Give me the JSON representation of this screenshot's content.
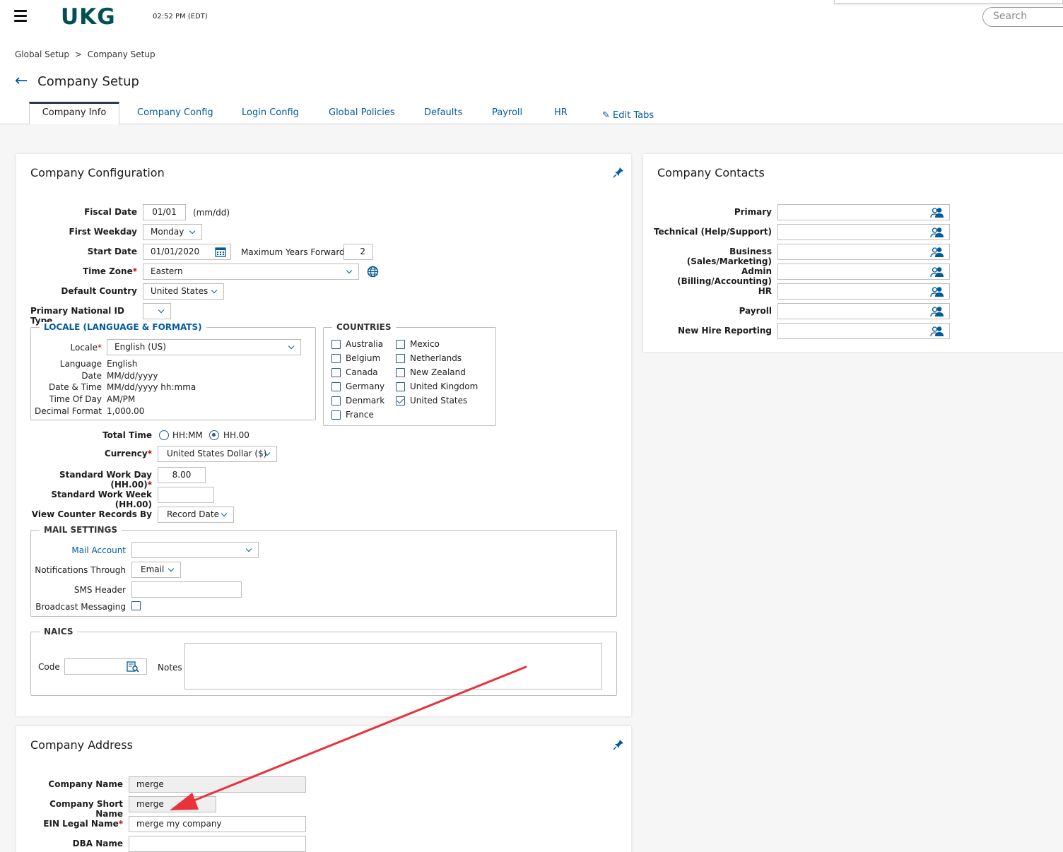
{
  "header": {
    "logo": "UKG",
    "clock": "02:52 PM (EDT)",
    "search_placeholder": "Search"
  },
  "breadcrumb": {
    "root": "Global Setup",
    "separator": ">",
    "current": "Company Setup"
  },
  "page_title": "Company Setup",
  "tabs": [
    {
      "label": "Company Info"
    },
    {
      "label": "Company Config"
    },
    {
      "label": "Login Config"
    },
    {
      "label": "Global Policies"
    },
    {
      "label": "Defaults"
    },
    {
      "label": "Payroll"
    },
    {
      "label": "HR"
    },
    {
      "label": "Edit Tabs"
    }
  ],
  "config": {
    "title": "Company Configuration",
    "fiscal_date_label": "Fiscal Date",
    "fiscal_date": "01/01",
    "fiscal_date_hint": "(mm/dd)",
    "first_weekday_label": "First Weekday",
    "first_weekday": "Monday",
    "start_date_label": "Start Date",
    "start_date": "01/01/2020",
    "max_years_label": "Maximum Years Forward",
    "max_years": "2",
    "time_zone_label": "Time Zone",
    "time_zone": "Eastern",
    "default_country_label": "Default Country",
    "default_country": "United States",
    "national_id_label": "Primary National ID Type",
    "national_id": "",
    "locale_legend": "LOCALE (LANGUAGE & FORMATS)",
    "locale_label": "Locale",
    "locale": "English (US)",
    "locale_details": [
      {
        "label": "Language",
        "value": "English"
      },
      {
        "label": "Date",
        "value": "MM/dd/yyyy"
      },
      {
        "label": "Date & Time",
        "value": "MM/dd/yyyy hh:mma"
      },
      {
        "label": "Time Of Day",
        "value": "AM/PM"
      },
      {
        "label": "Decimal Format",
        "value": "1,000.00"
      }
    ],
    "countries_legend": "COUNTRIES",
    "countries_col1": [
      {
        "name": "Australia",
        "checked": false
      },
      {
        "name": "Belgium",
        "checked": false
      },
      {
        "name": "Canada",
        "checked": false
      },
      {
        "name": "Germany",
        "checked": false
      },
      {
        "name": "Denmark",
        "checked": false
      },
      {
        "name": "France",
        "checked": false
      }
    ],
    "countries_col2": [
      {
        "name": "Mexico",
        "checked": false
      },
      {
        "name": "Netherlands",
        "checked": false
      },
      {
        "name": "New Zealand",
        "checked": false
      },
      {
        "name": "United Kingdom",
        "checked": false
      },
      {
        "name": "United States",
        "checked": true
      }
    ],
    "total_time_label": "Total Time",
    "total_time_opt1": "HH:MM",
    "total_time_opt2": "HH.00",
    "total_time_selected": "HH.00",
    "currency_label": "Currency",
    "currency": "United States Dollar ($)",
    "work_day_label": "Standard Work Day (HH.00)",
    "work_day": "8.00",
    "work_week_label": "Standard Work Week (HH.00)",
    "work_week": "",
    "counter_label": "View Counter Records By",
    "counter": "Record Date",
    "mail_legend": "MAIL SETTINGS",
    "mail_account_label": "Mail Account",
    "mail_account": "",
    "notif_label": "Notifications Through",
    "notif": "Email",
    "sms_label": "SMS Header",
    "sms": "",
    "broadcast_label": "Broadcast Messaging",
    "naics_legend": "NAICS",
    "code_label": "Code",
    "code": "",
    "notes_label": "Notes",
    "notes": ""
  },
  "contacts": {
    "title": "Company Contacts",
    "rows": [
      {
        "label": "Primary",
        "value": ""
      },
      {
        "label": "Technical (Help/Support)",
        "value": ""
      },
      {
        "label": "Business (Sales/Marketing)",
        "value": ""
      },
      {
        "label": "Admin (Billing/Accounting)",
        "value": ""
      },
      {
        "label": "HR",
        "value": ""
      },
      {
        "label": "Payroll",
        "value": ""
      },
      {
        "label": "New Hire Reporting",
        "value": ""
      }
    ]
  },
  "address": {
    "title": "Company Address",
    "company_name_label": "Company Name",
    "company_name": "merge",
    "short_name_label": "Company Short Name",
    "short_name": "merge",
    "ein_label": "EIN Legal Name",
    "ein": "merge my company",
    "dba_label": "DBA Name",
    "dba": ""
  },
  "colors": {
    "accent": "#005a9c",
    "brand": "#005151",
    "annotation_arrow": "#e8323c"
  }
}
